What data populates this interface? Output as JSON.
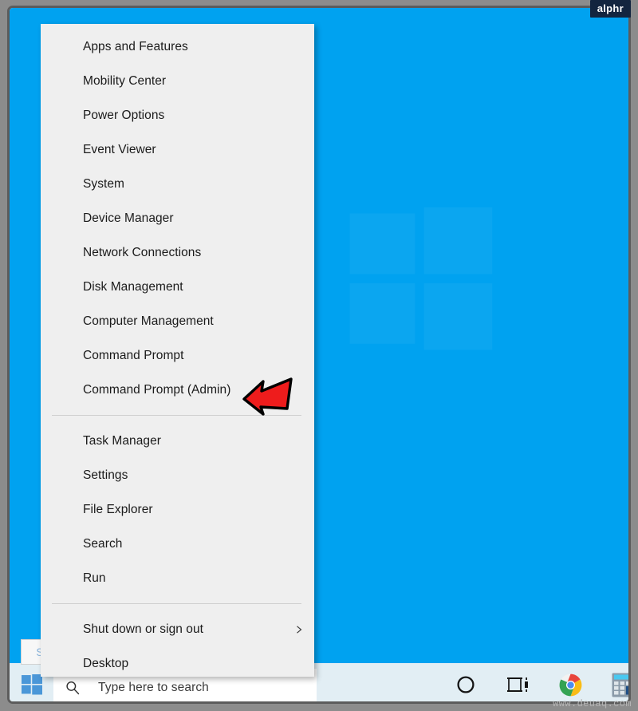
{
  "branding": {
    "logo_text": "alphr",
    "watermark_text": "www.deuaq.com"
  },
  "desktop": {
    "background_color": "#00a2f0"
  },
  "power_menu": {
    "groups": [
      {
        "items": [
          {
            "label": "Apps and Features",
            "submenu": false
          },
          {
            "label": "Mobility Center",
            "submenu": false
          },
          {
            "label": "Power Options",
            "submenu": false
          },
          {
            "label": "Event Viewer",
            "submenu": false
          },
          {
            "label": "System",
            "submenu": false
          },
          {
            "label": "Device Manager",
            "submenu": false
          },
          {
            "label": "Network Connections",
            "submenu": false
          },
          {
            "label": "Disk Management",
            "submenu": false
          },
          {
            "label": "Computer Management",
            "submenu": false
          },
          {
            "label": "Command Prompt",
            "submenu": false
          },
          {
            "label": "Command Prompt (Admin)",
            "submenu": false
          }
        ]
      },
      {
        "items": [
          {
            "label": "Task Manager",
            "submenu": false
          },
          {
            "label": "Settings",
            "submenu": false
          },
          {
            "label": "File Explorer",
            "submenu": false
          },
          {
            "label": "Search",
            "submenu": false
          },
          {
            "label": "Run",
            "submenu": false
          }
        ]
      },
      {
        "items": [
          {
            "label": "Shut down or sign out",
            "submenu": true
          },
          {
            "label": "Desktop",
            "submenu": false
          }
        ]
      }
    ]
  },
  "annotation": {
    "target_item": "Command Prompt (Admin)",
    "arrow_color": "#ee1c1c",
    "arrow_outline_color": "#000000",
    "direction": "left"
  },
  "taskbar": {
    "start_tooltip": "Start",
    "start_button_name": "Start",
    "search": {
      "placeholder": "Type here to search",
      "value": ""
    },
    "icons": [
      {
        "name": "cortana-icon",
        "label": "Cortana"
      },
      {
        "name": "task-view-icon",
        "label": "Task View"
      },
      {
        "name": "chrome-icon",
        "label": "Google Chrome"
      },
      {
        "name": "calculator-icon",
        "label": "Calculator"
      }
    ]
  }
}
